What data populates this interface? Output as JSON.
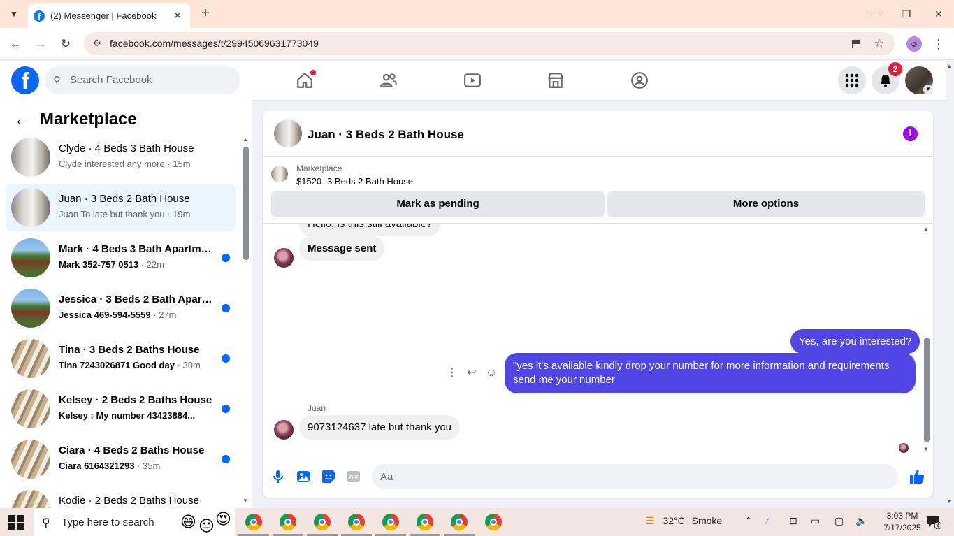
{
  "browser": {
    "tab_title": "(2) Messenger | Facebook",
    "url": "facebook.com/messages/t/29945069631773049"
  },
  "header": {
    "search_placeholder": "Search Facebook",
    "notification_count": "2"
  },
  "sidebar": {
    "title": "Marketplace",
    "conversations": [
      {
        "name": "Clyde · 4 Beds 3 Bath House",
        "preview": "Clyde interested any more",
        "time": "15m",
        "unread": false,
        "active": false,
        "thumb": "house"
      },
      {
        "name": "Juan · 3 Beds 2 Bath House",
        "preview": "Juan To late but thank you",
        "time": "19m",
        "unread": false,
        "active": true,
        "thumb": "house"
      },
      {
        "name": "Mark · 4 Beds 3 Bath Apartme...",
        "preview": "Mark 352-757 0513",
        "time": "22m",
        "unread": true,
        "active": false,
        "thumb": "apartment"
      },
      {
        "name": "Jessica · 3 Beds 2 Bath Apartm...",
        "preview": "Jessica 469-594-5559",
        "time": "27m",
        "unread": true,
        "active": false,
        "thumb": "apartment"
      },
      {
        "name": "Tina · 3 Beds 2 Baths House",
        "preview": "Tina 7243026871 Good day",
        "time": "30m",
        "unread": true,
        "active": false,
        "thumb": "porch"
      },
      {
        "name": "Kelsey · 2 Beds 2 Baths House",
        "preview": "Kelsey : My number 43423884...",
        "time": "",
        "unread": true,
        "active": false,
        "thumb": "porch"
      },
      {
        "name": "Ciara · 4 Beds 2 Baths House",
        "preview": "Ciara 6164321293",
        "time": "35m",
        "unread": true,
        "active": false,
        "thumb": "porch"
      },
      {
        "name": "Kodie · 2 Beds 2 Baths House",
        "preview": "",
        "time": "",
        "unread": false,
        "active": false,
        "thumb": "porch"
      }
    ]
  },
  "chat": {
    "title": "Juan · 3 Beds 2 Bath House",
    "marketplace_label": "Marketplace",
    "listing": "$1520- 3 Beds 2 Bath House",
    "mark_pending": "Mark as pending",
    "more_options": "More options",
    "messages": {
      "partial": "Hello, is this still available?",
      "in_1": "Message sent",
      "out_1": "Yes, are you interested?",
      "out_2": "\"yes it's available kindly drop your number for more information and requirements send me your number",
      "sender": "Juan",
      "in_2": "9073124637 late but thank you"
    },
    "composer_placeholder": "Aa"
  },
  "taskbar": {
    "search_placeholder": "Type here to search",
    "temperature": "32°C",
    "weather": "Smoke",
    "time": "3:03 PM",
    "date": "7/17/2025",
    "notifications": "4"
  },
  "colors": {
    "facebook_blue": "#0866ff",
    "outgoing_bubble": "#4f46e5",
    "active_row": "#ebf5ff",
    "badge_red": "#e41e3f",
    "info_purple": "#a100ff"
  }
}
